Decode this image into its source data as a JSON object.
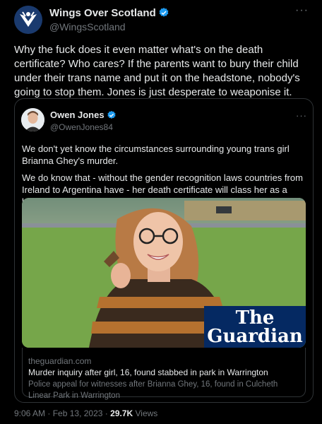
{
  "tweet": {
    "author_name": "Wings Over Scotland",
    "author_handle": "@WingsScotland",
    "text": "Why the fuck does it even matter what's on the death certificate? Who cares? If the parents want to bury their child under their trans name and put it on the headstone, nobody's going to stop them. Jones is just desperate to weaponise it.",
    "more_label": "···",
    "time": "9:06 AM",
    "date": "Feb 13, 2023",
    "views_count": "29.7K",
    "views_label": "Views",
    "separator": "·"
  },
  "quoted": {
    "author_name": "Owen Jones",
    "author_handle": "@OwenJones84",
    "more_label": "···",
    "para1": "We don't yet know the circumstances surrounding young trans girl Brianna Ghey's murder.",
    "para2": "We do know that - without the gender recognition laws countries from Ireland to Argentina have - her death certificate will class her as a boy.",
    "card": {
      "badge_line1": "The",
      "badge_line2": "Guardian",
      "domain": "theguardian.com",
      "title": "Murder inquiry after girl, 16, found stabbed in park in Warrington",
      "description": "Police appeal for witnesses after Brianna Ghey, 16, found in Culcheth Linear Park in Warrington"
    }
  },
  "colors": {
    "background": "#000000",
    "text": "#e7e9ea",
    "muted": "#71767b",
    "verified": "#1d9bf0",
    "guardian": "#052962",
    "border": "#2f3336"
  }
}
